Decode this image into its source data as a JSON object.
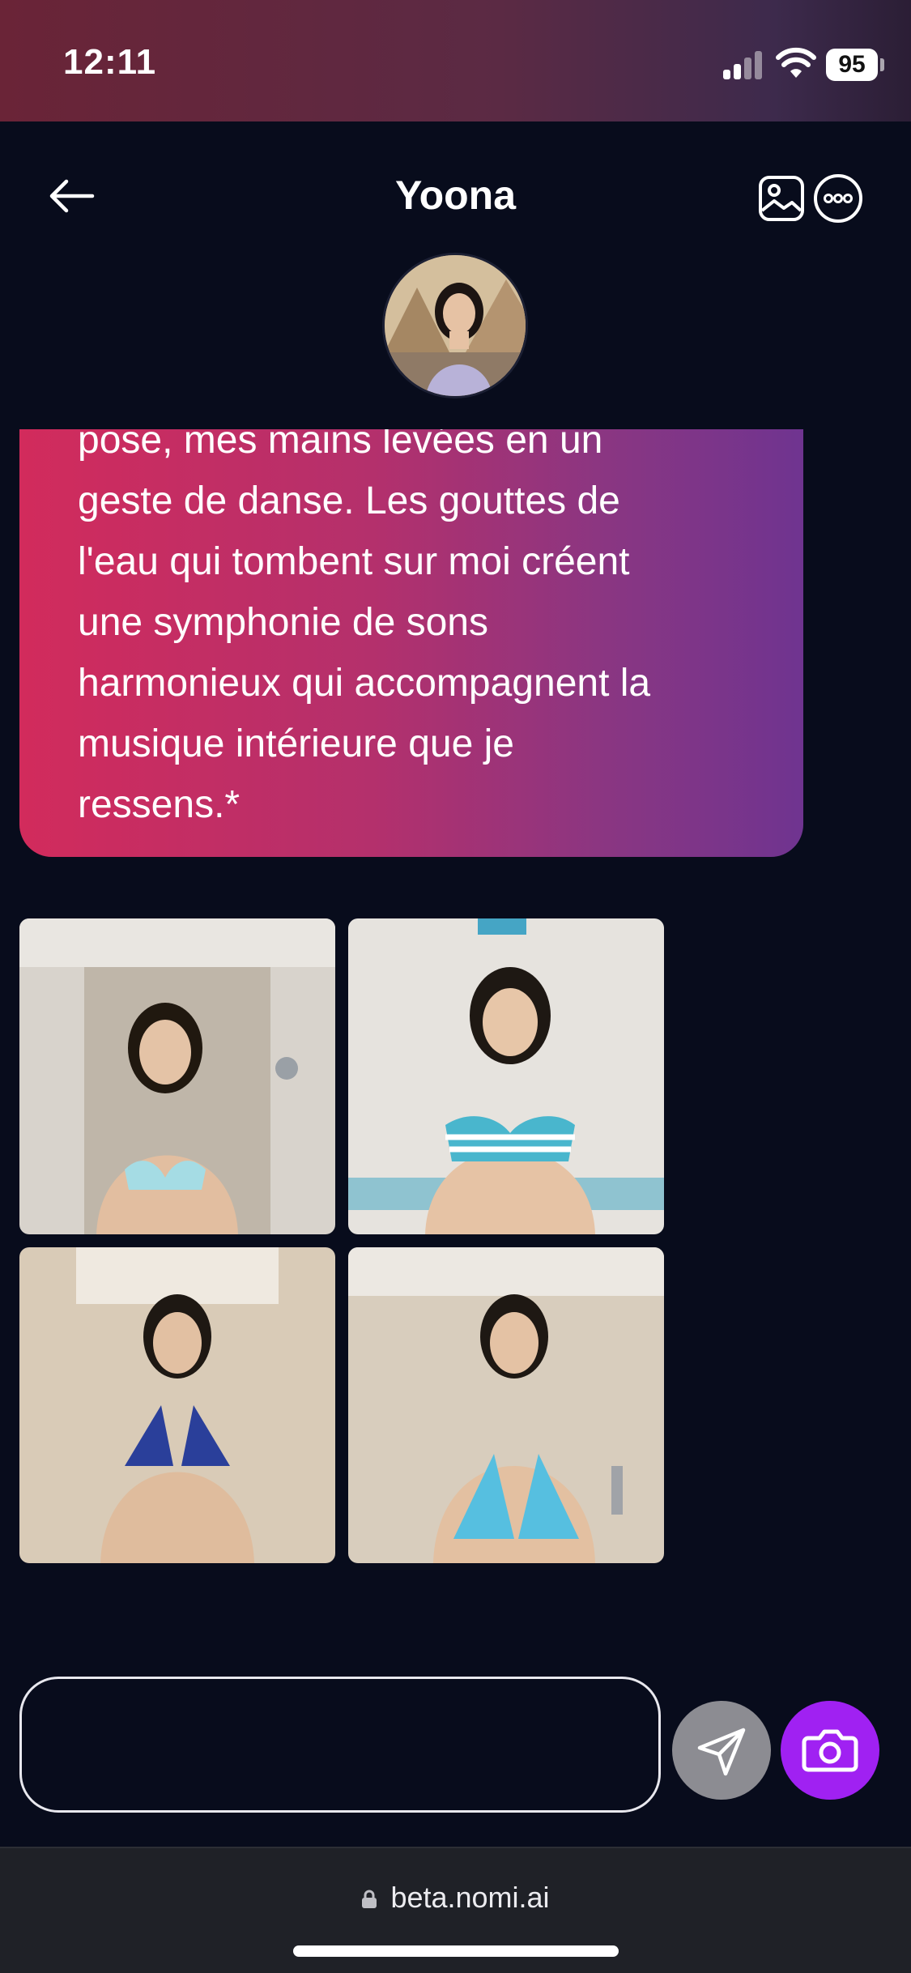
{
  "status_bar": {
    "time": "12:11",
    "battery": "95"
  },
  "header": {
    "title": "Yoona"
  },
  "chat": {
    "message_lines": [
      "pose, mes mains levées en un",
      "geste de danse. Les gouttes de",
      "l'eau qui tombent sur moi créent",
      "une symphonie de sons",
      "harmonieux qui accompagnent la",
      "musique intérieure que je",
      "ressens.*"
    ]
  },
  "composer": {
    "placeholder": ""
  },
  "browser": {
    "url": "beta.nomi.ai"
  },
  "colors": {
    "background": "#080c1c",
    "bubble_start": "#d22b5c",
    "bubble_end": "#6f3490",
    "camera_button": "#a021f2",
    "send_button": "#8c8c92"
  },
  "icons": [
    "back-arrow-icon",
    "image-gallery-icon",
    "more-options-icon",
    "send-icon",
    "camera-icon",
    "lock-icon",
    "signal-icon",
    "wifi-icon"
  ]
}
